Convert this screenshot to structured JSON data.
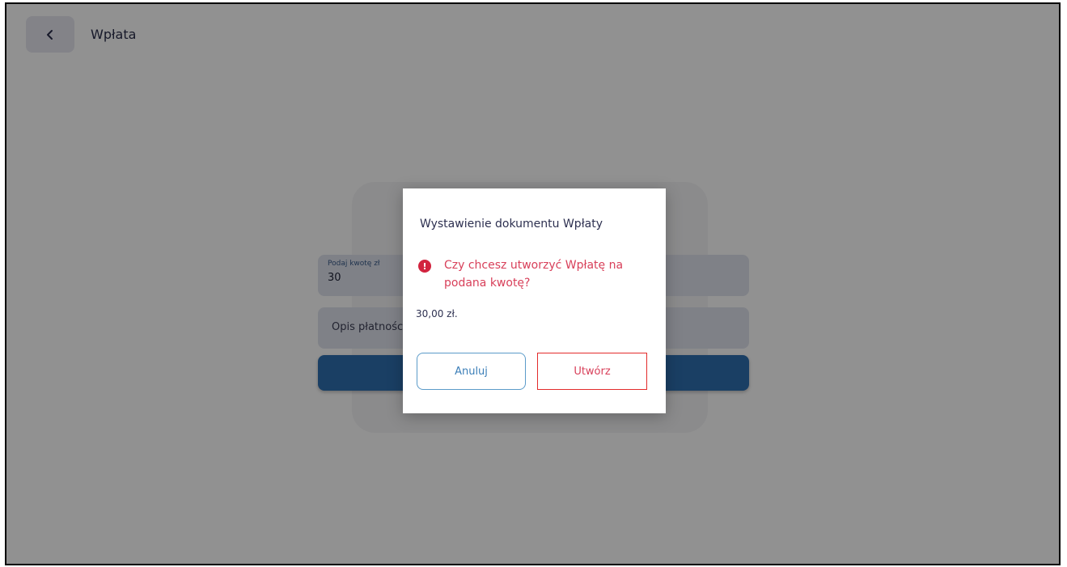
{
  "header": {
    "title": "Wpłata"
  },
  "form": {
    "amount_label": "Podaj kwotę zł",
    "amount_value": "30",
    "description_placeholder": "Opis płatnośc"
  },
  "dialog": {
    "title": "Wystawienie dokumentu Wpłaty",
    "alert_icon": "exclamation-circle-icon",
    "message": "Czy chcesz utworzyć Wpłatę na podana kwotę?",
    "amount": "30,00 zł.",
    "cancel_label": "Anuluj",
    "create_label": "Utwórz"
  },
  "colors": {
    "accent_blue": "#2f6fb0",
    "alert_red": "#d2243f",
    "overlay": "rgba(0,0,0,0.43)"
  }
}
